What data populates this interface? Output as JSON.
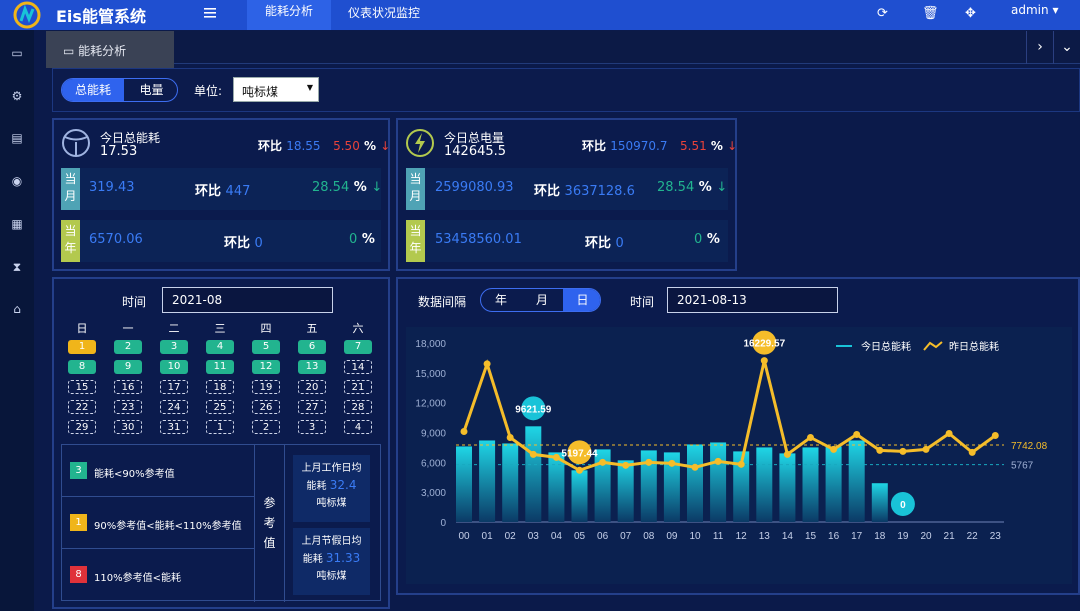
{
  "header": {
    "brand": "Eis能管系统",
    "nav": [
      "能耗分析",
      "仪表状况监控"
    ],
    "user": "admin"
  },
  "tabs": {
    "active": "能耗分析"
  },
  "filter": {
    "toggle": [
      "总能耗",
      "电量"
    ],
    "unit_label": "单位:",
    "unit_value": "吨标煤"
  },
  "kpi_energy": {
    "title": "今日总能耗",
    "value": "17.53",
    "ratio_label": "环比",
    "ratio_value": "18.55",
    "ratio_pct": "5.50",
    "pct_sign": "%",
    "arrow": "↓",
    "month_tag": "当月",
    "month_value": "319.43",
    "month_ratio_label": "环比",
    "month_ratio_value": "447",
    "month_pct": "28.54",
    "month_arrow": "↓",
    "year_tag": "当年",
    "year_value": "6570.06",
    "year_ratio_label": "环比",
    "year_ratio_value": "0",
    "year_pct": "0"
  },
  "kpi_power": {
    "title": "今日总电量",
    "value": "142645.5",
    "ratio_label": "环比",
    "ratio_value": "150970.7",
    "ratio_pct": "5.51",
    "pct_sign": "%",
    "arrow": "↓",
    "month_tag": "当月",
    "month_value": "2599080.93",
    "month_ratio_label": "环比",
    "month_ratio_value": "3637128.6",
    "month_pct": "28.54",
    "month_arrow": "↓",
    "year_tag": "当年",
    "year_value": "53458560.01",
    "year_ratio_label": "环比",
    "year_ratio_value": "0",
    "year_pct": "0"
  },
  "calendar": {
    "time_label": "时间",
    "month": "2021-08",
    "weekdays": [
      "日",
      "一",
      "二",
      "三",
      "四",
      "五",
      "六"
    ],
    "days": [
      {
        "t": "1",
        "s": "y"
      },
      {
        "t": "2",
        "s": "g"
      },
      {
        "t": "3",
        "s": "g"
      },
      {
        "t": "4",
        "s": "g"
      },
      {
        "t": "5",
        "s": "g"
      },
      {
        "t": "6",
        "s": "g"
      },
      {
        "t": "7",
        "s": "g"
      },
      {
        "t": "8",
        "s": "g"
      },
      {
        "t": "9",
        "s": "g"
      },
      {
        "t": "10",
        "s": "g"
      },
      {
        "t": "11",
        "s": "g"
      },
      {
        "t": "12",
        "s": "g"
      },
      {
        "t": "13",
        "s": "g"
      },
      {
        "t": "14",
        "s": "d"
      },
      {
        "t": "15",
        "s": "d"
      },
      {
        "t": "16",
        "s": "d"
      },
      {
        "t": "17",
        "s": "d"
      },
      {
        "t": "18",
        "s": "d"
      },
      {
        "t": "19",
        "s": "d"
      },
      {
        "t": "20",
        "s": "d"
      },
      {
        "t": "21",
        "s": "d"
      },
      {
        "t": "22",
        "s": "d"
      },
      {
        "t": "23",
        "s": "d"
      },
      {
        "t": "24",
        "s": "d"
      },
      {
        "t": "25",
        "s": "d"
      },
      {
        "t": "26",
        "s": "d"
      },
      {
        "t": "27",
        "s": "d"
      },
      {
        "t": "28",
        "s": "d"
      },
      {
        "t": "29",
        "s": "d"
      },
      {
        "t": "30",
        "s": "d"
      },
      {
        "t": "31",
        "s": "d"
      },
      {
        "t": "1",
        "s": "d"
      },
      {
        "t": "2",
        "s": "d"
      },
      {
        "t": "3",
        "s": "d"
      },
      {
        "t": "4",
        "s": "d"
      }
    ],
    "legend": [
      {
        "num": "3",
        "text": "能耗<90%参考值",
        "color": "#22b48f"
      },
      {
        "num": "1",
        "text": "90%参考值<能耗<110%参考值",
        "color": "#f0b51a"
      },
      {
        "num": "8",
        "text": "110%参考值<能耗",
        "color": "#e0323a"
      }
    ],
    "ref_label": "参考值",
    "ref_work_title": "上月工作日均",
    "ref_work_label": "能耗",
    "ref_work_value": "32.4",
    "ref_work_unit": "吨标煤",
    "ref_holiday_title": "上月节假日均",
    "ref_holiday_label": "能耗",
    "ref_holiday_value": "31.33",
    "ref_holiday_unit": "吨标煤"
  },
  "chart_controls": {
    "interval_label": "数据间隔",
    "segments": [
      "年",
      "月",
      "日"
    ],
    "active_segment": "日",
    "time_label": "时间",
    "date": "2021-08-13"
  },
  "chart_data": {
    "type": "bar",
    "categories": [
      "00",
      "01",
      "02",
      "03",
      "04",
      "05",
      "06",
      "07",
      "08",
      "09",
      "10",
      "11",
      "12",
      "13",
      "14",
      "15",
      "16",
      "17",
      "18",
      "19",
      "20",
      "21",
      "22",
      "23"
    ],
    "ylim": [
      0,
      18000
    ],
    "yticks": [
      "0",
      "3,000",
      "6,000",
      "9,000",
      "12,000",
      "15,000",
      "18,000"
    ],
    "series": [
      {
        "name": "今日总能耗",
        "type": "bar",
        "color": "#19c3d8",
        "values": [
          7600,
          8200,
          7900,
          9621.59,
          7000,
          5197.44,
          7300,
          6200,
          7200,
          7000,
          7800,
          8000,
          7100,
          7500,
          6900,
          7500,
          7600,
          8200,
          3900,
          0,
          null,
          null,
          null,
          null
        ]
      },
      {
        "name": "昨日总能耗",
        "type": "line",
        "color": "#f5bd2a",
        "values": [
          9100,
          15900,
          8500,
          6800,
          6500,
          5200,
          6000,
          5700,
          6000,
          5900,
          5500,
          6100,
          5800,
          16229.57,
          6800,
          8500,
          7300,
          8800,
          7200,
          7100,
          7300,
          8900,
          7000,
          8700
        ]
      }
    ],
    "markers": [
      {
        "label": "9621.59",
        "index": 3,
        "value": 9621.59,
        "color": "#19c3d8"
      },
      {
        "label": "5197.44",
        "index": 5,
        "value": 5197.44,
        "color": "#f5bd2a"
      },
      {
        "label": "16229.57",
        "index": 13,
        "value": 16229.57,
        "color": "#f5bd2a"
      },
      {
        "label": "0",
        "index": 19,
        "value": 0,
        "color": "#19c3d8"
      }
    ],
    "avg_lines": [
      {
        "label": "7742.08",
        "value": 7742.08,
        "color": "#f5bd2a"
      },
      {
        "label": "5767",
        "value": 5767,
        "color": "#19a9c0"
      }
    ]
  }
}
